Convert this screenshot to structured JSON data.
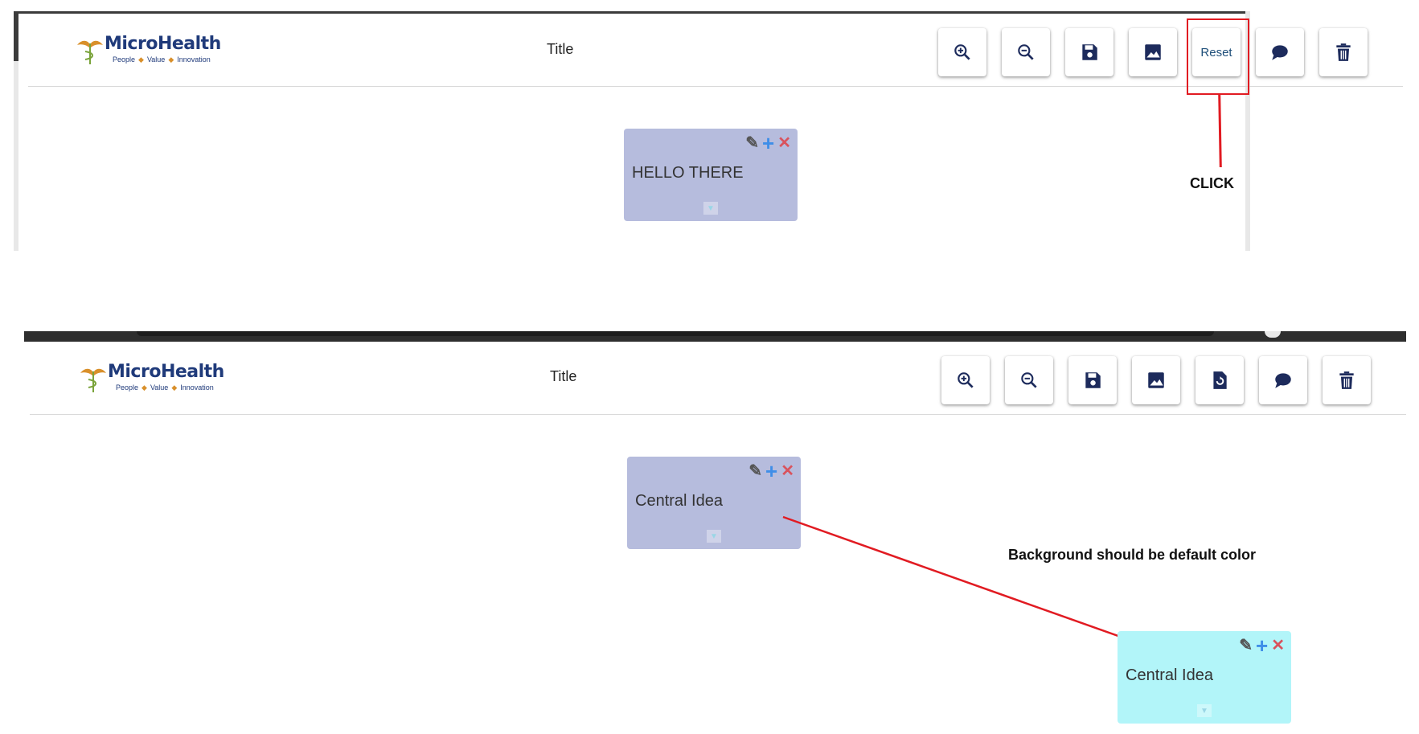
{
  "top_panel": {
    "logo": {
      "brand": "MicroHealth",
      "tagline_1": "People",
      "tagline_2": "Value",
      "tagline_3": "Innovation"
    },
    "title": "Title",
    "toolbar": {
      "zoom_in_icon": "zoom-in-icon",
      "zoom_out_icon": "zoom-out-icon",
      "save_icon": "floppy-disk-icon",
      "image_icon": "image-icon",
      "reset_label": "Reset",
      "comment_icon": "speech-bubble-icon",
      "delete_icon": "trash-icon"
    },
    "node": {
      "text": "HELLO THERE",
      "background": "#b6bcdd"
    }
  },
  "bottom_panel": {
    "logo": {
      "brand": "MicroHealth",
      "tagline_1": "People",
      "tagline_2": "Value",
      "tagline_3": "Innovation"
    },
    "title": "Title",
    "toolbar": {
      "zoom_in_icon": "zoom-in-icon",
      "zoom_out_icon": "zoom-out-icon",
      "save_icon": "floppy-disk-icon",
      "image_icon": "image-icon",
      "reset_icon": "file-reset-icon",
      "comment_icon": "speech-bubble-icon",
      "delete_icon": "trash-icon"
    },
    "node_current": {
      "text": "Central Idea",
      "background": "#b6bcdd"
    },
    "node_expected": {
      "text": "Central Idea",
      "background": "#b2f5f9"
    }
  },
  "annotations": {
    "click_label": "CLICK",
    "expected_label": "Background should be default color",
    "color": "#e11b22"
  },
  "colors": {
    "brand_navy": "#1f3a7a",
    "brand_orange": "#d9902b",
    "icon_navy": "#1d2b5c"
  }
}
